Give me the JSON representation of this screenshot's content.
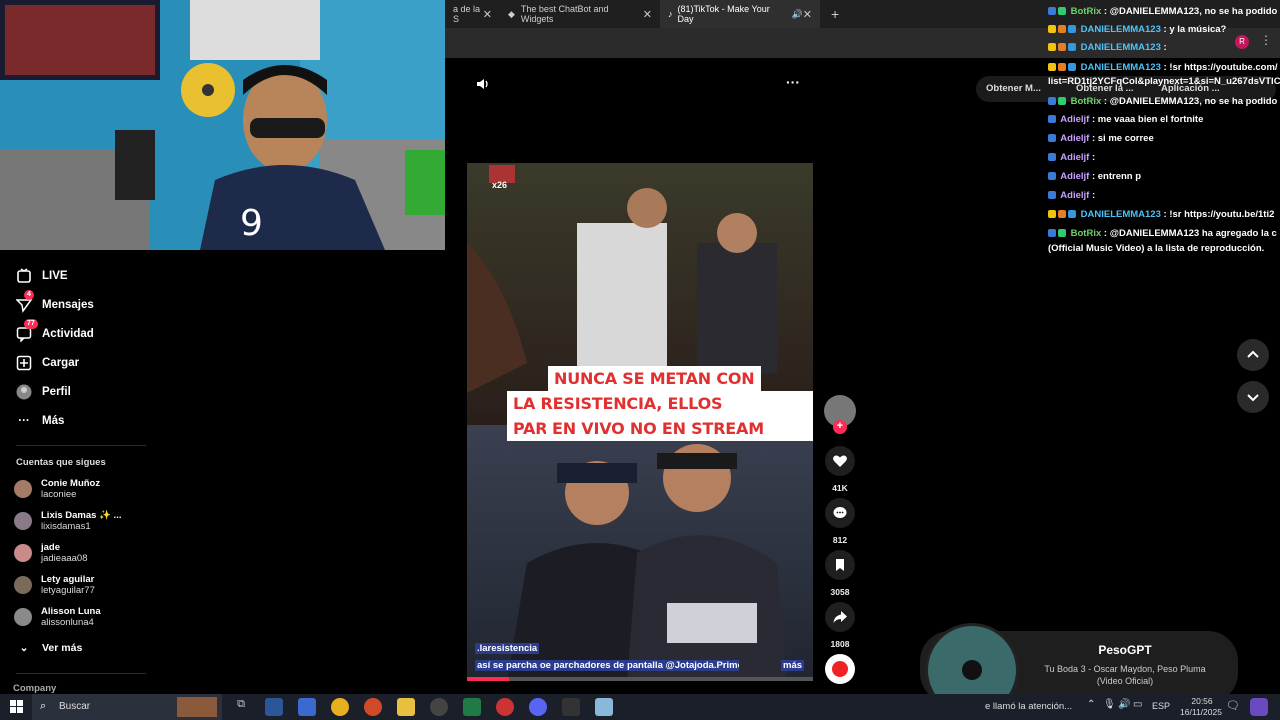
{
  "browser": {
    "tabs": [
      {
        "label": "a de la S",
        "active": false
      },
      {
        "label": "The best ChatBot and Widgets",
        "active": false
      },
      {
        "label": "(81)TikTok - Make Your Day",
        "active": true
      }
    ],
    "new_tab": "+",
    "ext_buttons": [
      "Obtener M...",
      "Obtener la ...",
      "Aplicación ..."
    ]
  },
  "sidebar": {
    "items": [
      {
        "label": "LIVE",
        "icon": "live-icon",
        "badge": ""
      },
      {
        "label": "Mensajes",
        "icon": "message-icon",
        "badge": "4"
      },
      {
        "label": "Actividad",
        "icon": "activity-icon",
        "badge": "77"
      },
      {
        "label": "Cargar",
        "icon": "upload-icon",
        "badge": ""
      },
      {
        "label": "Perfil",
        "icon": "profile-icon",
        "badge": ""
      },
      {
        "label": "Más",
        "icon": "more-icon",
        "badge": ""
      }
    ],
    "following_title": "Cuentas que sigues",
    "following": [
      {
        "name": "Conie Muñoz",
        "user": "laconiee",
        "color": "#a47b66"
      },
      {
        "name": "Lixis Damas ✨ ...",
        "user": "lixisdamas1",
        "color": "#8a7a88"
      },
      {
        "name": "jade",
        "user": "jadieaaa08",
        "color": "#c98a8a"
      },
      {
        "name": "Lety aguilar",
        "user": "letyaguilar77",
        "color": "#7a6a5a"
      },
      {
        "name": "Alisson Luna",
        "user": "alissonluna4",
        "color": "#8a8a8a"
      }
    ],
    "see_more": "Ver más",
    "company": "Company"
  },
  "video": {
    "overlay_lines": [
      "NUNCA SE METAN CON",
      "LA RESISTENCIA, ELLOS PARCHAN",
      "EN VIVO NO EN STREAM"
    ],
    "author": ".laresistencia",
    "description": "así se parcha oe parchadores de pantalla @Jotajoda.Prime ...",
    "more": "más",
    "multiplier": "x26"
  },
  "actions": {
    "likes": "41K",
    "comments": "812",
    "saves": "3058",
    "shares": "1808"
  },
  "chat": [
    {
      "user": "BotRix",
      "ucls": "g",
      "msg": " : @DANIELEMMA123, no se ha podido",
      "badges": [
        "#3a7bd5",
        "#2ecc71"
      ]
    },
    {
      "user": "DANIELEMMA123",
      "ucls": "u",
      "msg": " : y la música?",
      "badges": [
        "#f1c40f",
        "#e67e22",
        "#3498db"
      ]
    },
    {
      "user": "DANIELEMMA123",
      "ucls": "u",
      "msg": " :",
      "badges": [
        "#f1c40f",
        "#e67e22",
        "#3498db"
      ]
    },
    {
      "user": "DANIELEMMA123",
      "ucls": "u",
      "msg": " : !sr https://youtube.com/",
      "badges": [
        "#f1c40f",
        "#e67e22",
        "#3498db"
      ]
    },
    {
      "user": "",
      "ucls": "u",
      "msg": "list=RD1tj2YCFqCol&playnext=1&si=N_u267dsVTIC",
      "badges": []
    },
    {
      "user": "BotRix",
      "ucls": "g",
      "msg": " : @DANIELEMMA123, no se ha podido",
      "badges": [
        "#3a7bd5",
        "#2ecc71"
      ]
    },
    {
      "user": "Adieljf",
      "ucls": "p",
      "msg": " : me vaaa bien el fortnite",
      "badges": [
        "#3a7bd5"
      ]
    },
    {
      "user": "Adieljf",
      "ucls": "p",
      "msg": " : si me corree",
      "badges": [
        "#3a7bd5"
      ]
    },
    {
      "user": "Adieljf",
      "ucls": "p",
      "msg": " :",
      "badges": [
        "#3a7bd5"
      ]
    },
    {
      "user": "Adieljf",
      "ucls": "p",
      "msg": " : entrenn p",
      "badges": [
        "#3a7bd5"
      ]
    },
    {
      "user": "Adieljf",
      "ucls": "p",
      "msg": " :",
      "badges": [
        "#3a7bd5"
      ]
    },
    {
      "user": "DANIELEMMA123",
      "ucls": "u",
      "msg": " : !sr https://youtu.be/1ti2",
      "badges": [
        "#f1c40f",
        "#e67e22",
        "#3498db"
      ]
    },
    {
      "user": "BotRix",
      "ucls": "g",
      "msg": " : @DANIELEMMA123 ha agregado la c",
      "badges": [
        "#3a7bd5",
        "#2ecc71"
      ]
    },
    {
      "user": "",
      "ucls": "u",
      "msg": "(Official Music Video) a la lista de reproducción.",
      "badges": []
    }
  ],
  "music": {
    "title": "PesoGPT",
    "subtitle": "Tu Boda 3 - Oscar Maydon, Peso Pluma (Video Oficial)"
  },
  "taskbar": {
    "search": "Buscar",
    "notification": "e llamó la atención...",
    "lang": "ESP",
    "time": "20:56",
    "date": "16/11/2025"
  },
  "colors": {
    "accent": "#fe2c55",
    "chat_blue": "#4fc3f7",
    "chat_green": "#6cd36c",
    "chat_purple": "#c9a0ff"
  }
}
